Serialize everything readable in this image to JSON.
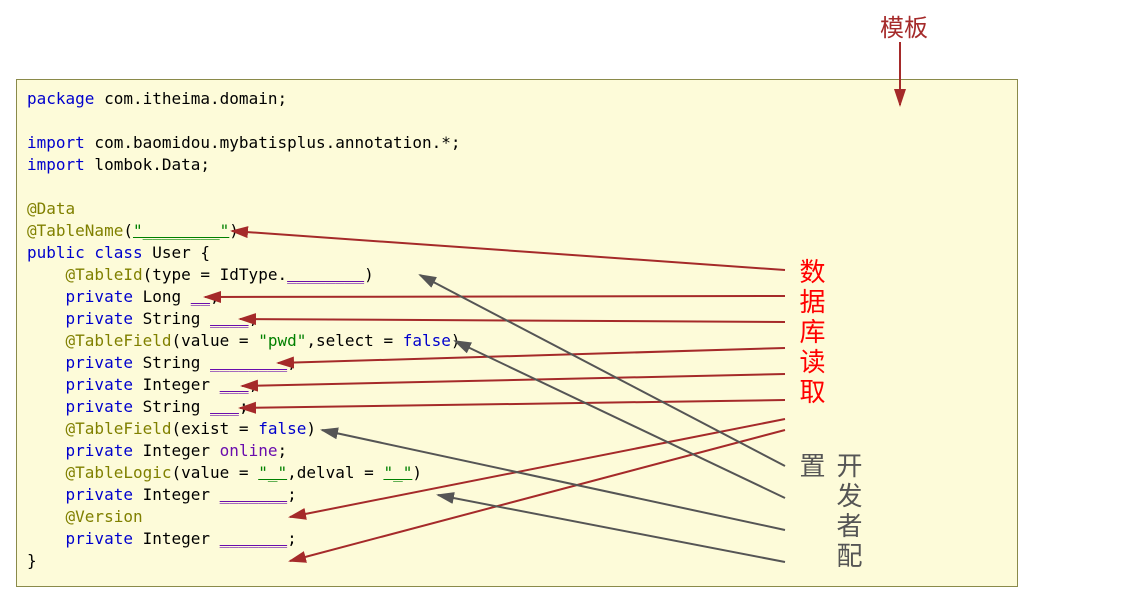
{
  "title_label": "模板",
  "side_labels": {
    "red": "数据库读取",
    "gray": "开发者配置"
  },
  "code": {
    "l1a": "package",
    "l1b": " com.itheima.domain;",
    "l2a": "import",
    "l2b": " com.baomidou.mybatisplus.annotation.*;",
    "l3a": "import",
    "l3b": " lombok.Data;",
    "l4": "@Data",
    "l5a": "@TableName",
    "l5b": "(",
    "l5c": "\"________\"",
    "l5d": ")",
    "l6a": "public class",
    "l6b": " User {",
    "l7a": "    ",
    "l7b": "@TableId",
    "l7c": "(type = IdType.",
    "l7d": "________",
    "l7e": ")",
    "l8a": "    ",
    "l8b": "private",
    "l8c": " Long ",
    "l8d": "__",
    "l8e": ";",
    "l9a": "    ",
    "l9b": "private",
    "l9c": " String ",
    "l9d": "____",
    "l9e": ";",
    "l10a": "    ",
    "l10b": "@TableField",
    "l10c": "(value = ",
    "l10d": "\"pwd\"",
    "l10e": ",select = ",
    "l10f": "false",
    "l10g": ")",
    "l11a": "    ",
    "l11b": "private",
    "l11c": " String ",
    "l11d": "________",
    "l11e": ";",
    "l12a": "    ",
    "l12b": "private",
    "l12c": " Integer ",
    "l12d": "___",
    "l12e": ";",
    "l13a": "    ",
    "l13b": "private",
    "l13c": " String ",
    "l13d": "___",
    "l13e": ";",
    "l14a": "    ",
    "l14b": "@TableField",
    "l14c": "(exist = ",
    "l14d": "false",
    "l14e": ")",
    "l15a": "    ",
    "l15b": "private",
    "l15c": " Integer ",
    "l15d": "online",
    "l15e": ";",
    "l16a": "    ",
    "l16b": "@TableLogic",
    "l16c": "(value = ",
    "l16d": "\"_\"",
    "l16e": ",delval = ",
    "l16f": "\"_\"",
    "l16g": ")",
    "l17a": "    ",
    "l17b": "private",
    "l17c": " Integer ",
    "l17d": "_______",
    "l17e": ";",
    "l18a": "    ",
    "l18b": "@Version",
    "l19a": "    ",
    "l19b": "private",
    "l19c": " Integer ",
    "l19d": "_______",
    "l19e": ";",
    "l20": "}"
  }
}
